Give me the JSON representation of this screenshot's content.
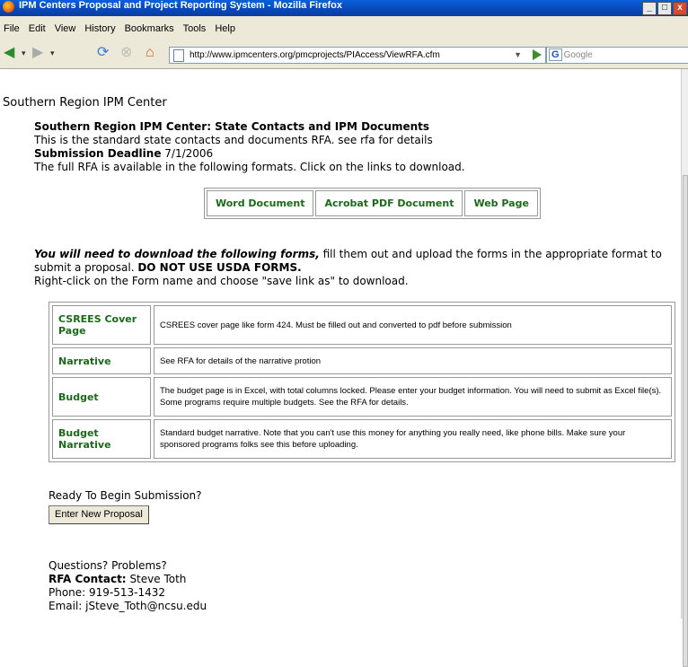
{
  "window": {
    "title": "IPM Centers Proposal and Project Reporting System - Mozilla Firefox"
  },
  "menu": [
    "File",
    "Edit",
    "View",
    "History",
    "Bookmarks",
    "Tools",
    "Help"
  ],
  "toolbar": {
    "url": "http://www.ipmcenters.org/pmcprojects/PIAccess/ViewRFA.cfm",
    "search_placeholder": "Google"
  },
  "page": {
    "org": "Southern Region IPM Center",
    "rfa_title": "Southern Region IPM Center: State Contacts and IPM Documents",
    "description": "This is the standard state contacts and documents RFA. see rfa for details",
    "deadline_label": "Submission Deadline",
    "deadline": "7/1/2006",
    "formats_intro": "The full RFA is available in the following formats. Click on the links to download.",
    "formats": [
      "Word Document",
      "Acrobat PDF Document",
      "Web Page"
    ],
    "forms_intro_bold": "You will need to download the following forms,",
    "forms_intro_rest": " fill them out and upload the forms in the appropriate format to submit a proposal. ",
    "forms_warning": "DO NOT USE USDA FORMS.",
    "forms_hint": "Right-click on the Form name and choose \"save link as\" to download.",
    "forms": [
      {
        "name": "CSREES Cover Page",
        "description": "CSREES cover page like form 424. Must be filled out and converted to pdf before submission"
      },
      {
        "name": "Narrative",
        "description": "See RFA for details of the narrative protion"
      },
      {
        "name": "Budget",
        "description": "The budget page is in Excel, with total columns locked. Please enter your budget information. You will need to submit as Excel file(s). Some programs require multiple budgets. See the RFA for details."
      },
      {
        "name": "Budget Narrative",
        "description": "Standard budget narrative. Note that you can't use this money for anything you really need, like phone bills. Make sure your sponsored programs folks see this before uploading."
      }
    ],
    "ready_heading": "Ready To Begin Submission?",
    "enter_button": "Enter New Proposal",
    "questions_heading": "Questions? Problems?",
    "contact_label": "RFA Contact:",
    "contact_name": "Steve Toth",
    "phone": "Phone: 919-513-1432",
    "email": "Email: jSteve_Toth@ncsu.edu"
  },
  "colors": {
    "link_green": "#1a6a1a",
    "titlebar": "#0847b9"
  }
}
